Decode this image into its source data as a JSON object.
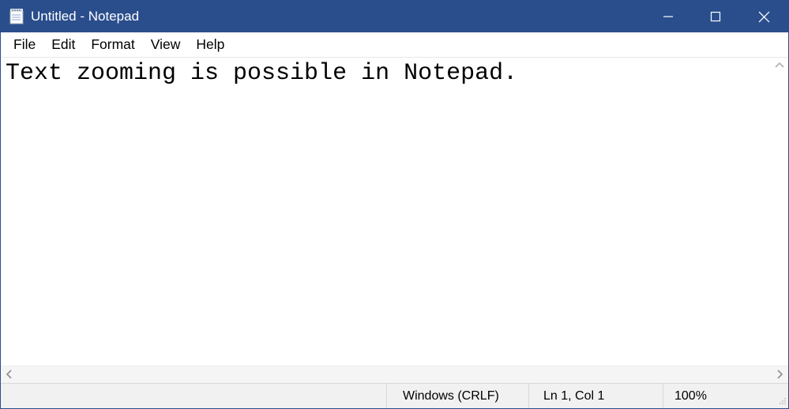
{
  "window": {
    "title": "Untitled - Notepad"
  },
  "menu": {
    "file": "File",
    "edit": "Edit",
    "format": "Format",
    "view": "View",
    "help": "Help"
  },
  "editor": {
    "content": "Text zooming is possible in Notepad."
  },
  "status": {
    "encoding": "Windows (CRLF)",
    "position": "Ln 1, Col 1",
    "zoom": "100%"
  }
}
